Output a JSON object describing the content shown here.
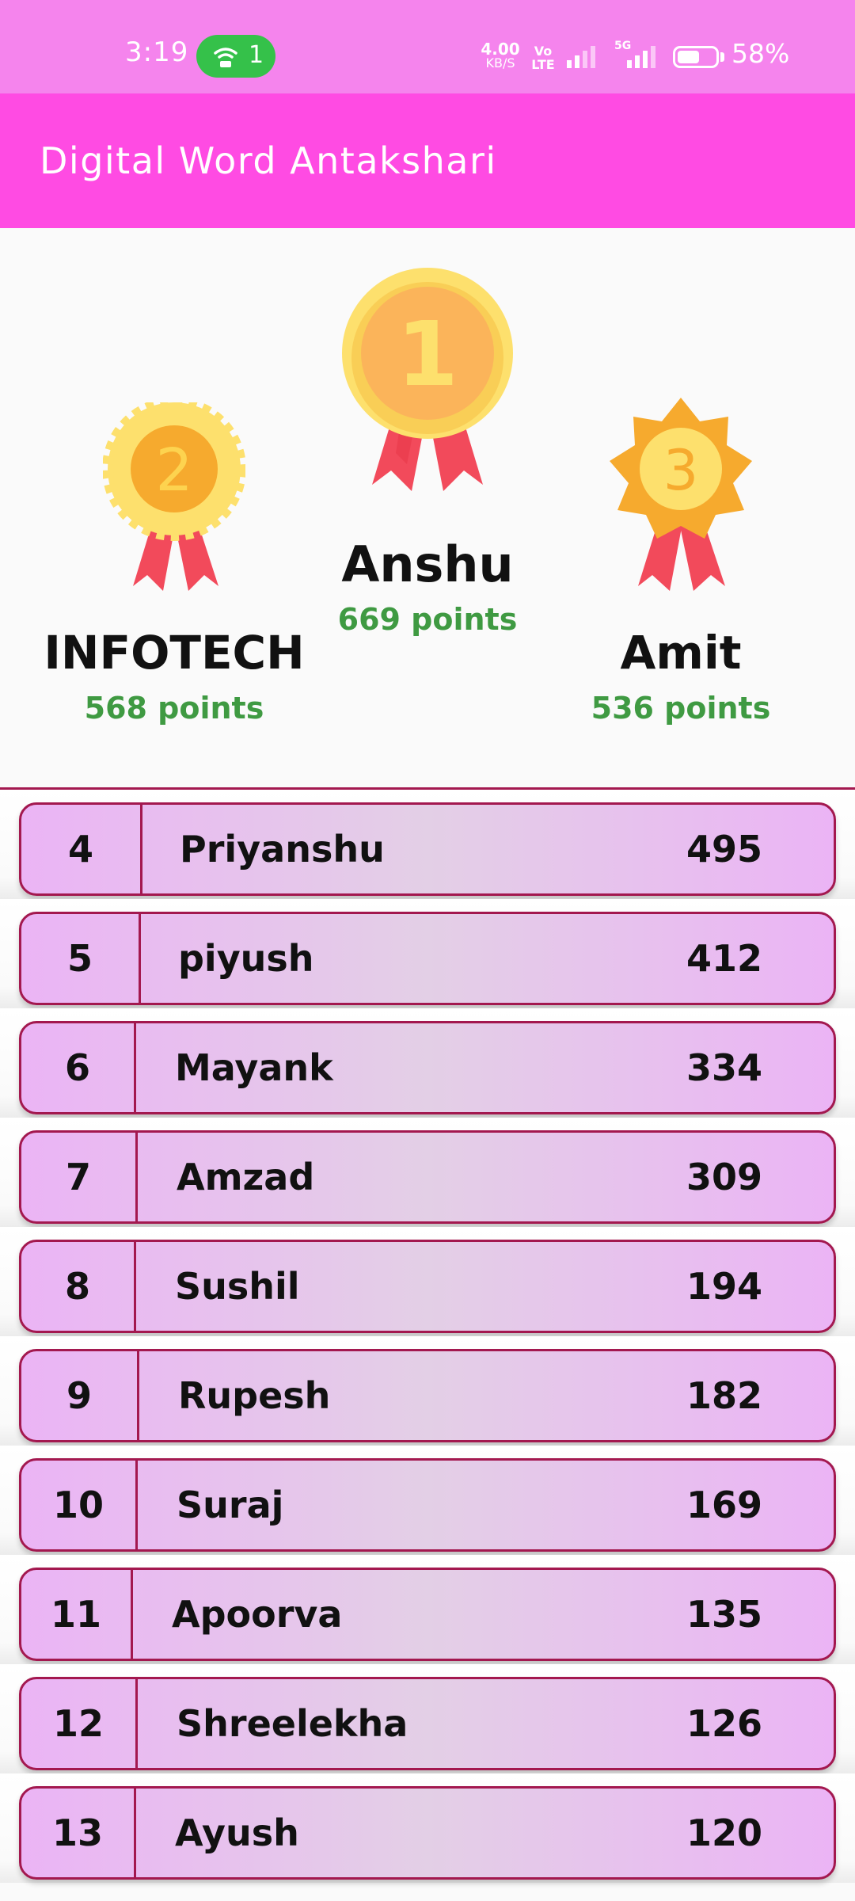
{
  "status_bar": {
    "time": "3:19",
    "hotspot_count": "1",
    "net_speed_value": "4.00",
    "net_speed_unit": "KB/S",
    "volte_top": "Vo",
    "volte_bottom": "LTE",
    "network_5g": "5G",
    "battery_percent": "58%",
    "battery_level": 0.58
  },
  "app_bar": {
    "title": "Digital Word Antakshari"
  },
  "podium": {
    "first": {
      "rank": "1",
      "name": "Anshu",
      "points": "669 points"
    },
    "second": {
      "rank": "2",
      "name": "INFOTECH",
      "points": "568 points"
    },
    "third": {
      "rank": "3",
      "name": "Amit",
      "points": "536 points"
    }
  },
  "leaderboard": [
    {
      "rank": "4",
      "name": "Priyanshu",
      "score": "495"
    },
    {
      "rank": "5",
      "name": "piyush",
      "score": "412"
    },
    {
      "rank": "6",
      "name": "Mayank",
      "score": "334"
    },
    {
      "rank": "7",
      "name": "Amzad",
      "score": "309"
    },
    {
      "rank": "8",
      "name": "Sushil",
      "score": "194"
    },
    {
      "rank": "9",
      "name": "Rupesh",
      "score": "182"
    },
    {
      "rank": "10",
      "name": "Suraj",
      "score": "169"
    },
    {
      "rank": "11",
      "name": "Apoorva",
      "score": "135"
    },
    {
      "rank": "12",
      "name": "Shreelekha",
      "score": "126"
    },
    {
      "rank": "13",
      "name": "Ayush",
      "score": "120"
    }
  ],
  "colors": {
    "status_bar": "#f584ed",
    "app_bar": "#ff4be3",
    "points_green": "#3f9a42",
    "row_border": "#a3184f",
    "row_fill": "#ebb4f5"
  }
}
